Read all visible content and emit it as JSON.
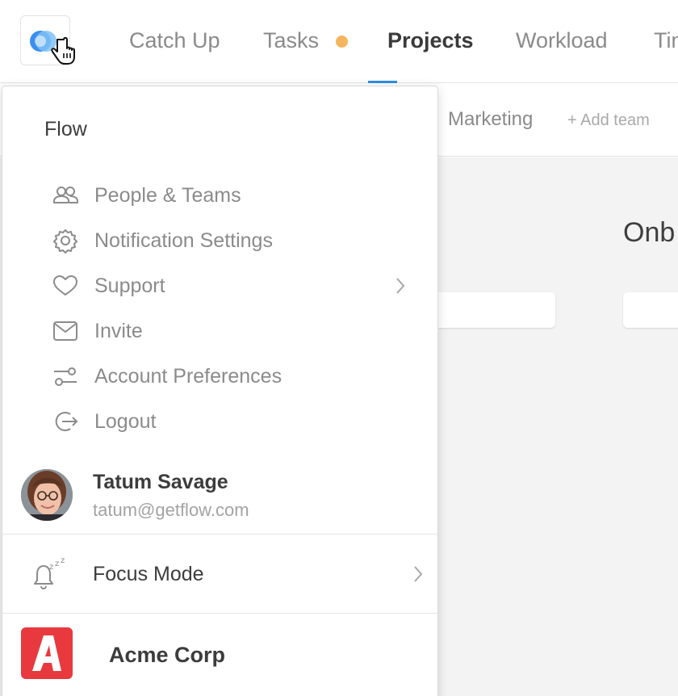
{
  "nav": {
    "items": [
      "Catch Up",
      "Tasks",
      "Projects",
      "Workload",
      "Tim"
    ],
    "active": "Projects",
    "notification_color": "#f5b55d",
    "accent": "#2f8fe0"
  },
  "teams": {
    "tab": "Marketing",
    "add_label": "+ Add team"
  },
  "board": {
    "column_title": "Onb"
  },
  "menu": {
    "title": "Flow",
    "items": [
      {
        "label": "People & Teams",
        "icon": "people-icon"
      },
      {
        "label": "Notification Settings",
        "icon": "gear-icon"
      },
      {
        "label": "Support",
        "icon": "heart-icon",
        "has_submenu": true
      },
      {
        "label": "Invite",
        "icon": "envelope-icon"
      },
      {
        "label": "Account Preferences",
        "icon": "sliders-icon"
      },
      {
        "label": "Logout",
        "icon": "logout-icon"
      }
    ],
    "user": {
      "name": "Tatum Savage",
      "email": "tatum@getflow.com"
    },
    "focus_mode": {
      "label": "Focus Mode",
      "icon": "bell-snooze-icon"
    },
    "organization": {
      "name": "Acme Corp",
      "logo_letter": "A",
      "color": "#e8393f"
    }
  }
}
